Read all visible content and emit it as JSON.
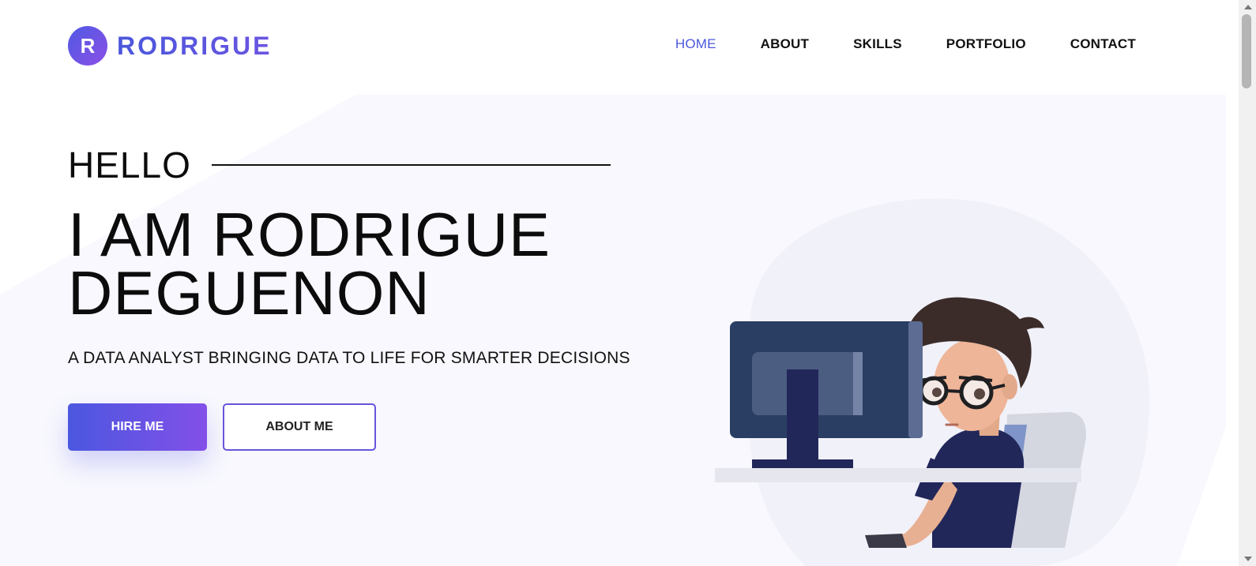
{
  "brand": {
    "initial": "R",
    "name": "RODRIGUE"
  },
  "nav": {
    "items": [
      {
        "label": "HOME",
        "active": true
      },
      {
        "label": "ABOUT",
        "active": false
      },
      {
        "label": "SKILLS",
        "active": false
      },
      {
        "label": "PORTFOLIO",
        "active": false
      },
      {
        "label": "CONTACT",
        "active": false
      }
    ]
  },
  "hero": {
    "greeting": "HELLO",
    "name_line1": "I AM RODRIGUE",
    "name_line2": "DEGUENON",
    "subtitle": "A DATA ANALYST BRINGING DATA TO LIFE FOR SMARTER DECISIONS",
    "primary_button": "HIRE ME",
    "secondary_button": "ABOUT ME",
    "illustration": "developer-at-computer-illustration"
  },
  "colors": {
    "accent": "#4a57dc",
    "accent_gradient_end": "#8350e8",
    "hero_bg": "#f8f8fe",
    "text": "#111111"
  }
}
